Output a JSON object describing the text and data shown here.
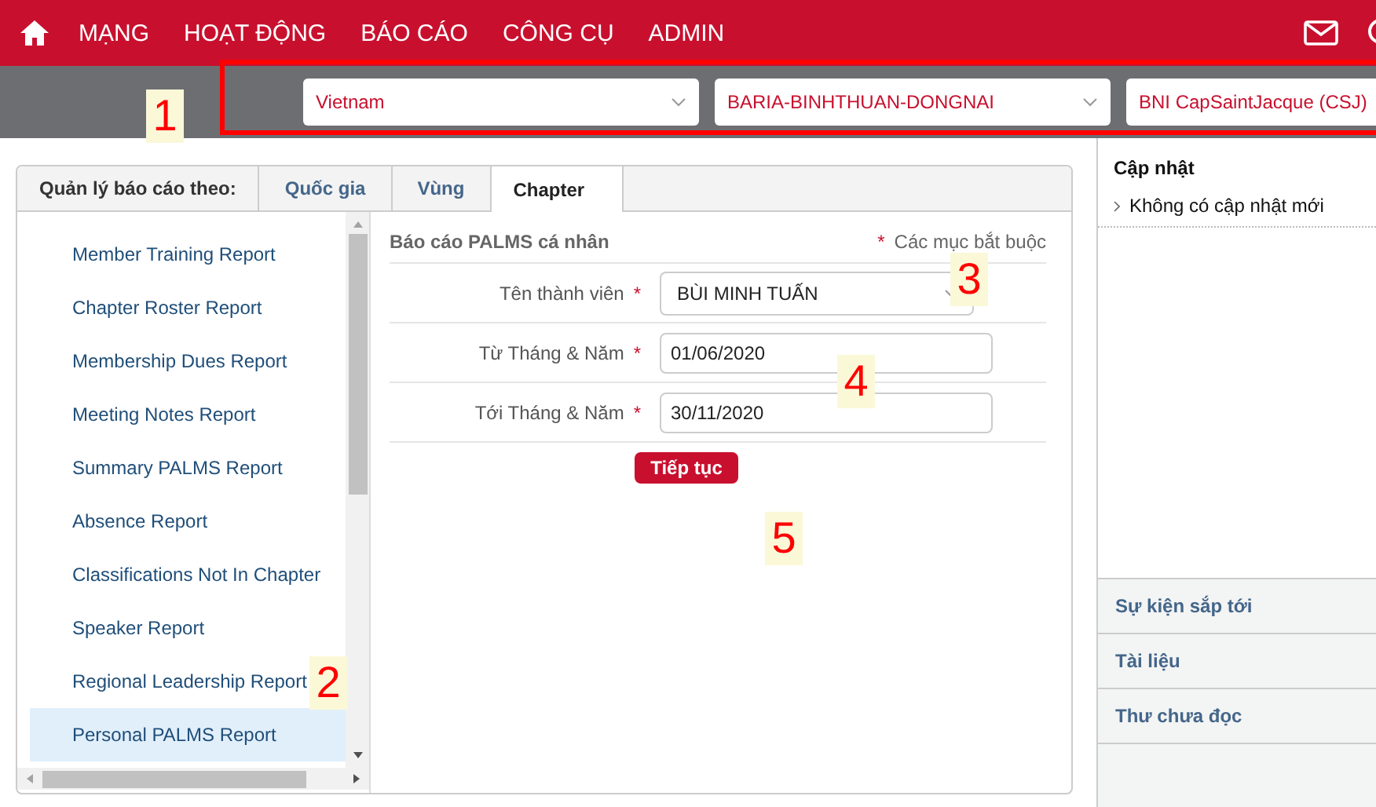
{
  "nav": {
    "items": [
      "MẠNG",
      "HOẠT ĐỘNG",
      "BÁO CÁO",
      "CÔNG CỤ",
      "ADMIN"
    ]
  },
  "filters": [
    {
      "value": "Vietnam"
    },
    {
      "value": "BARIA-BINHTHUAN-DONGNAI"
    },
    {
      "value": "BNI CapSaintJacque (CSJ)"
    }
  ],
  "report_panel": {
    "tabs_label": "Quản lý báo cáo theo:",
    "tabs": [
      {
        "label": "Quốc gia",
        "selected": false
      },
      {
        "label": "Vùng",
        "selected": false
      },
      {
        "label": "Chapter",
        "selected": true
      }
    ],
    "reports": [
      {
        "label": "Member Training Report",
        "selected": false
      },
      {
        "label": "Chapter Roster Report",
        "selected": false
      },
      {
        "label": "Membership Dues Report",
        "selected": false
      },
      {
        "label": "Meeting Notes Report",
        "selected": false
      },
      {
        "label": "Summary PALMS Report",
        "selected": false
      },
      {
        "label": "Absence Report",
        "selected": false
      },
      {
        "label": "Classifications Not In Chapter",
        "selected": false
      },
      {
        "label": "Speaker Report",
        "selected": false
      },
      {
        "label": "Regional Leadership Report",
        "selected": false
      },
      {
        "label": "Personal PALMS Report",
        "selected": true
      }
    ],
    "form": {
      "title": "Báo cáo PALMS cá nhân",
      "required_mark": "*",
      "required_note": "Các mục bắt buộc",
      "fields": [
        {
          "kind": "select",
          "label": "Tên thành viên",
          "required_mark": "*",
          "value": "BÙI MINH TUẤN"
        },
        {
          "kind": "text",
          "label": "Từ Tháng & Năm",
          "required_mark": "*",
          "value": "01/06/2020"
        },
        {
          "kind": "text",
          "label": "Tới Tháng & Năm",
          "required_mark": "*",
          "value": "30/11/2020"
        }
      ],
      "submit": "Tiếp tục"
    }
  },
  "sidebar": {
    "heading": "Cập nhật",
    "updates": [
      "Không có cập nhật mới"
    ],
    "sections": [
      "Sự kiện sắp tới",
      "Tài liệu",
      "Thư chưa đọc"
    ]
  },
  "annotations": [
    "1",
    "2",
    "3",
    "4",
    "5"
  ]
}
